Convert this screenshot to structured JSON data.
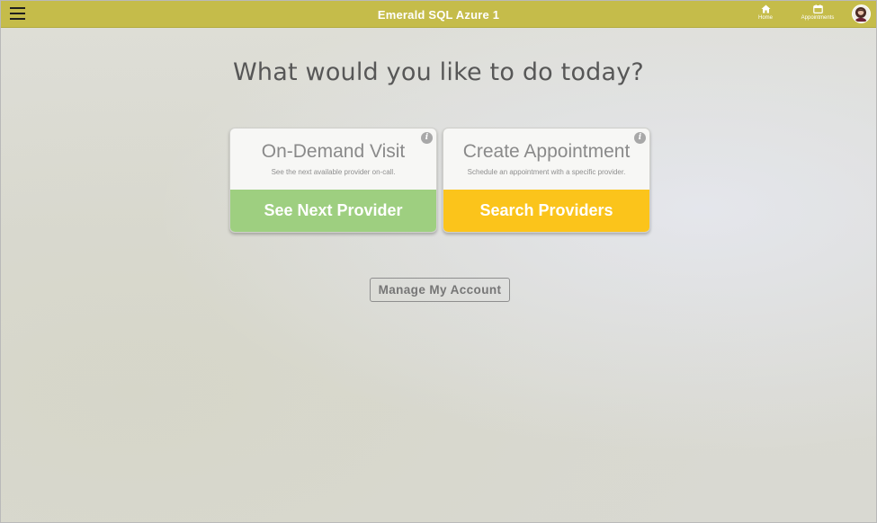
{
  "header": {
    "title": "Emerald SQL Azure 1",
    "menu_icon": "hamburger-menu-icon",
    "nav": [
      {
        "label": "Home",
        "icon": "home-icon"
      },
      {
        "label": "Appointments",
        "icon": "calendar-icon"
      }
    ],
    "avatar_icon": "user-avatar-icon",
    "bar_color": "#c5bc4a"
  },
  "main": {
    "headline": "What would you like to do today?",
    "cards": [
      {
        "title": "On-Demand Visit",
        "subtitle": "See the next available provider on-call.",
        "action": "See Next Provider",
        "action_color": "#9ecf80",
        "info_icon": "info-icon"
      },
      {
        "title": "Create Appointment",
        "subtitle": "Schedule an appointment with a specific provider.",
        "action": "Search Providers",
        "action_color": "#fbc41b",
        "info_icon": "info-icon"
      }
    ],
    "manage_account": "Manage My Account"
  }
}
